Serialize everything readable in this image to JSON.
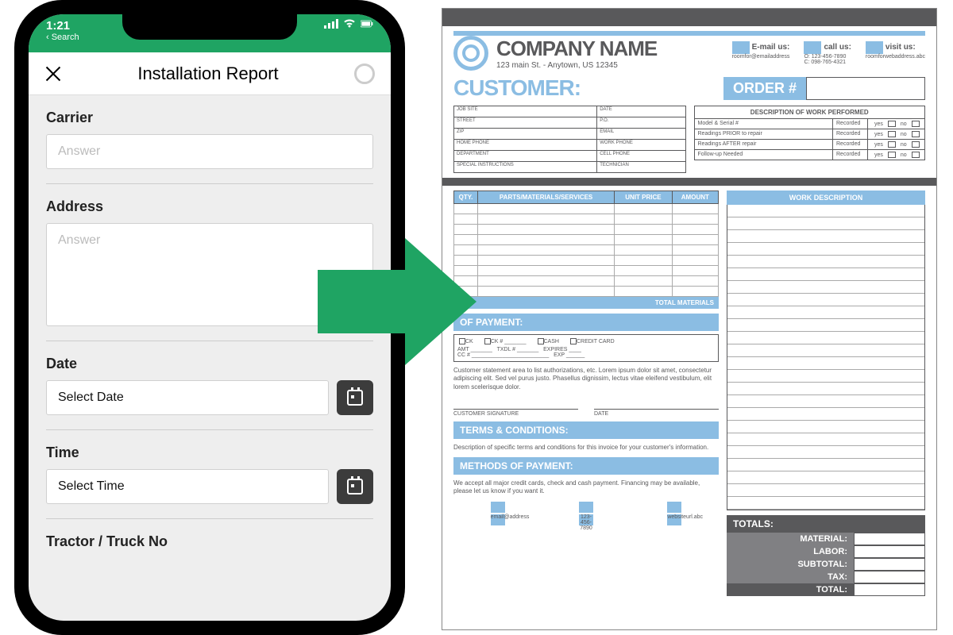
{
  "phone": {
    "status": {
      "time": "1:21",
      "back": "‹ Search"
    },
    "header": {
      "title": "Installation Report"
    },
    "fields": {
      "carrier": {
        "label": "Carrier",
        "placeholder": "Answer"
      },
      "address": {
        "label": "Address",
        "placeholder": "Answer"
      },
      "date": {
        "label": "Date",
        "placeholder": "Select Date"
      },
      "time": {
        "label": "Time",
        "placeholder": "Select Time"
      },
      "tractor": {
        "label": "Tractor / Truck No"
      }
    }
  },
  "doc": {
    "company": {
      "name": "COMPANY NAME",
      "address": "123 main St. - Anytown, US 12345"
    },
    "contacts": {
      "email": {
        "label": "E-mail us:",
        "value": "roomfor@emailaddress"
      },
      "call": {
        "label": "call us:",
        "value1": "O: 123-456-7890",
        "value2": "C: 098-765-4321"
      },
      "visit": {
        "label": "visit us:",
        "value": "roomforwebaddress.abc"
      }
    },
    "customer_label": "CUSTOMER:",
    "order_label": "ORDER #",
    "cust_grid": [
      "JOB SITE",
      "DATE",
      "STREET",
      "P.O.",
      "ZIP",
      "EMAIL",
      "HOME PHONE",
      "WORK PHONE",
      "DEPARTMENT",
      "CELL PHONE",
      "SPECIAL INSTRUCTIONS",
      "TECHNICIAN"
    ],
    "dwp": {
      "title": "DESCRIPTION OF WORK PERFORMED",
      "rows": [
        "Model & Serial #",
        "Readings PRIOR to repair",
        "Readings AFTER repair",
        "Follow-up Needed"
      ],
      "rec": "Recorded",
      "yes": "yes",
      "no": "no"
    },
    "mat_table": {
      "headers": [
        "QTY.",
        "PARTS/MATERIALS/SERVICES",
        "UNIT PRICE",
        "AMOUNT"
      ],
      "total": "TOTAL MATERIALS"
    },
    "payment": {
      "band": "OF PAYMENT:",
      "opts": [
        "CK",
        "CK #",
        "CASH",
        "CREDIT CARD"
      ],
      "line2": [
        "AMT",
        "TXDL #",
        "EXPIRES"
      ],
      "line3": [
        "CC #",
        "EXP"
      ]
    },
    "statement": "Customer statement area to list authorizations, etc.  Lorem ipsum dolor sit amet, consectetur adipiscing elit. Sed vel purus justo. Phasellus dignissim, lectus vitae eleifend vestibulum, elit lorem scelerisque dolor.",
    "sig": {
      "cust": "CUSTOMER SIGNATURE",
      "date": "DATE"
    },
    "terms": {
      "band": "TERMS & CONDITIONS:",
      "text": "Description of specific terms and conditions for this invoice for your customer's information."
    },
    "methods": {
      "band": "METHODS OF PAYMENT:",
      "text": "We accept all major credit cards, check and cash payment. Financing may be available, please let us know if you want it."
    },
    "footer": {
      "email": "email@address",
      "phone": "123-456-7890",
      "web": "websiteurl.abc"
    },
    "work_desc": "WORK DESCRIPTION",
    "totals": {
      "head": "TOTALS:",
      "rows": [
        "MATERIAL:",
        "LABOR:",
        "SUBTOTAL:",
        "TAX:"
      ],
      "grand": "TOTAL:"
    }
  }
}
